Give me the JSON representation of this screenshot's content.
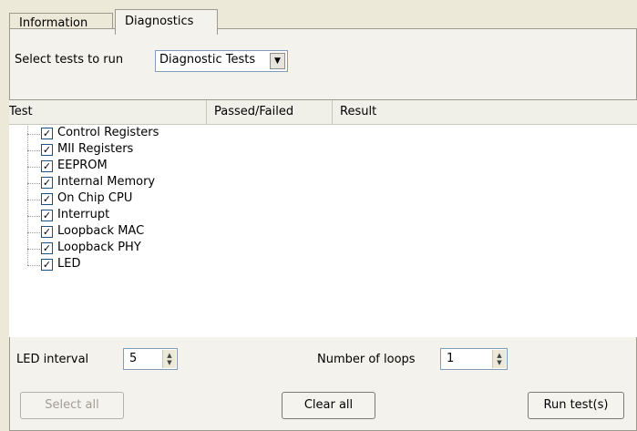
{
  "tabs": [
    {
      "label": "Information"
    },
    {
      "label": "Diagnostics"
    }
  ],
  "select": {
    "label": "Select tests to run",
    "value": "Diagnostic Tests"
  },
  "table": {
    "columns": [
      "Test",
      "Passed/Failed",
      "Result"
    ],
    "tests": [
      {
        "label": "Control Registers",
        "checked": true
      },
      {
        "label": "MII Registers",
        "checked": true
      },
      {
        "label": "EEPROM",
        "checked": true
      },
      {
        "label": "Internal Memory",
        "checked": true
      },
      {
        "label": "On Chip CPU",
        "checked": true
      },
      {
        "label": "Interrupt",
        "checked": true
      },
      {
        "label": "Loopback MAC",
        "checked": true
      },
      {
        "label": "Loopback PHY",
        "checked": true
      },
      {
        "label": "LED",
        "checked": true
      }
    ]
  },
  "led_interval": {
    "label": "LED interval",
    "value": "5"
  },
  "loops": {
    "label": "Number of loops",
    "value": "1"
  },
  "buttons": {
    "select_all": "Select all",
    "clear_all": "Clear all",
    "run": "Run test(s)"
  }
}
